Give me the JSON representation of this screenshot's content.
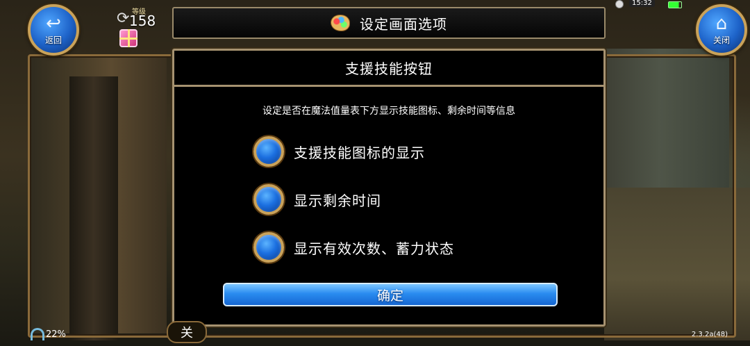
{
  "top_bar": {
    "back_label": "返回",
    "close_label": "关闭",
    "level_label": "等级",
    "level_value": "158",
    "title": "设定画面选项",
    "ghost_value": "0",
    "clock": "15:32"
  },
  "dialog": {
    "title": "支援技能按钮",
    "description": "设定是否在魔法值量表下方显示技能图标、剩余时间等信息",
    "options": [
      {
        "label": "支援技能图标的显示",
        "selected": true
      },
      {
        "label": "显示剩余时间",
        "selected": true
      },
      {
        "label": "显示有效次数、蓄力状态",
        "selected": true
      }
    ],
    "confirm_label": "确定"
  },
  "bottom_bar": {
    "toggle_label": "关",
    "percent": "22%",
    "version": "2.3.2a(48)"
  },
  "colors": {
    "accent_blue": "#2a8cf0",
    "frame_gold": "#a69270",
    "dialog_bg": "#000000"
  },
  "icons": {
    "back": "back-arrow-icon",
    "close": "home-icon",
    "palette": "palette-icon",
    "gift": "gift-icon",
    "radio": "radio-on-icon"
  }
}
